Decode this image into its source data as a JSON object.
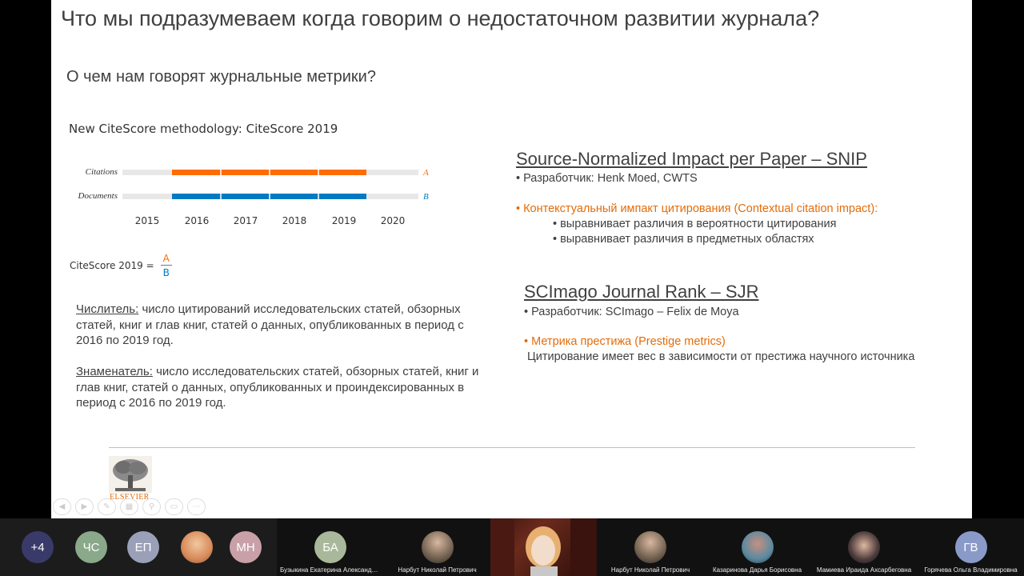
{
  "slide": {
    "title": "Что мы подразумеваем когда говорим о недостаточном развитии журнала?",
    "subtitle": "О чем нам говорят журнальные метрики?",
    "citescore": {
      "title": "New CiteScore methodology: CiteScore 2019",
      "row1_label": "Citations",
      "row2_label": "Documents",
      "row1_letter": "A",
      "row2_letter": "B",
      "years": [
        "2015",
        "2016",
        "2017",
        "2018",
        "2019",
        "2020"
      ],
      "formula_label": "CiteScore 2019 =",
      "numerator_letter": "A",
      "denominator_letter": "B",
      "colors": {
        "citations": "#ff6c00",
        "documents": "#007bc2",
        "track": "#e8e8e8"
      }
    },
    "para1": {
      "label": "Числитель:",
      "text": " число цитирований исследовательских статей, обзорных статей, книг и глав книг, статей о данных, опубликованных в период с 2016 по 2019 год."
    },
    "para2": {
      "label": "Знаменатель:",
      "text": " число исследовательских статей, обзорных статей, книг и глав книг, статей о данных, опубликованных и проиндексированных  в период с 2016 по 2019 год."
    },
    "snip": {
      "title": "Source-Normalized Impact per Paper – SNIP",
      "dev": "• Разработчик: Henk Moed, CWTS",
      "highlight": "• Контекстуальный импакт цитирования (Contextual citation impact):",
      "sub1": "• выравнивает различия в вероятности цитирования",
      "sub2": "• выравнивает различия в предметных областях"
    },
    "sjr": {
      "title": "SCImago Journal Rank – SJR",
      "dev": "• Разработчик: SCImago – Felix de Moya",
      "highlight": "• Метрика престижа (Prestige metrics)",
      "desc": "Цитирование имеет вес в зависимости от престижа научного источника"
    },
    "logo_text": "ELSEVIER",
    "accent": "#e36c09"
  },
  "participants": [
    {
      "initials": "+4",
      "color": "#3a3a6a",
      "name": ""
    },
    {
      "initials": "ЧС",
      "color": "#8aa88a",
      "name": ""
    },
    {
      "initials": "ЕП",
      "color": "#9aa0b8",
      "name": ""
    },
    {
      "initials": "",
      "color": "#d88a5a",
      "name": ""
    },
    {
      "initials": "МН",
      "color": "#c9a0a8",
      "name": ""
    },
    {
      "initials": "БА",
      "color": "#a9b89a",
      "name": "Бузыкина Екатерина Александров..."
    },
    {
      "initials": "",
      "color": "#6a5a4a",
      "name": "Нарбут Николай Петрович"
    },
    {
      "initials": "",
      "color": "#000000",
      "name": ""
    },
    {
      "initials": "",
      "color": "#6a5a4a",
      "name": "Нарбут Николай Петрович"
    },
    {
      "initials": "",
      "color": "#5a8aa0",
      "name": "Казаринова Дарья Борисовна"
    },
    {
      "initials": "",
      "color": "#4a3a3a",
      "name": "Мамиева Ираида Ахсарбеговна"
    },
    {
      "initials": "ГВ",
      "color": "#8a9ac8",
      "name": "Горячева Ольга Владимировна"
    }
  ]
}
